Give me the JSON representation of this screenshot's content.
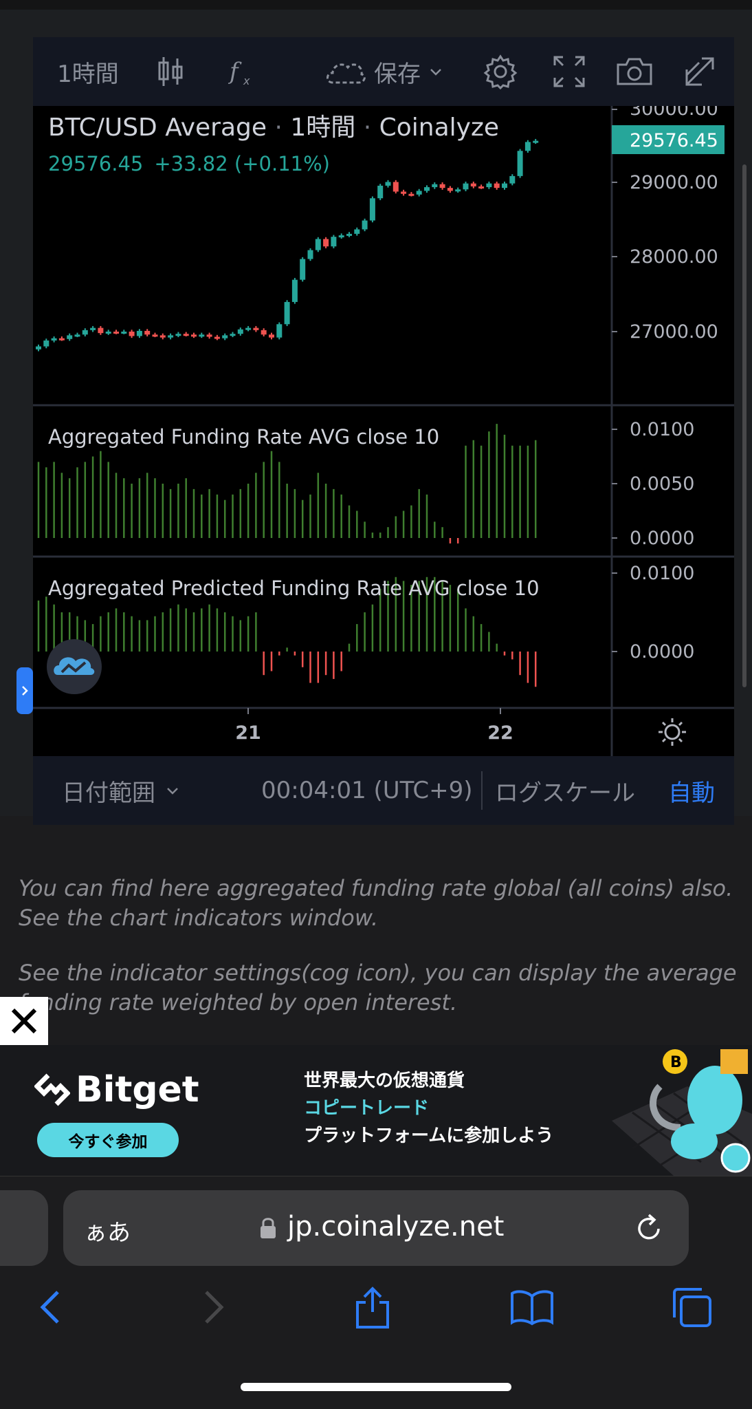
{
  "toolbar": {
    "interval": "1時間",
    "save_label": "保存"
  },
  "chart": {
    "title": "BTC/USD Average",
    "title_interval": "1時間",
    "title_source": "Coinalyze",
    "last_price": "29576.45",
    "change": "+33.82 (+0.11%)",
    "price_badge": "29576.45",
    "price_ticks": [
      "30000.00",
      "29000.00",
      "28000.00",
      "27000.00"
    ],
    "funding_title": "Aggregated Funding Rate AVG close 10",
    "funding_ticks": [
      "0.0100",
      "0.0050",
      "0.0000"
    ],
    "predicted_title": "Aggregated Predicted Funding Rate AVG close 10",
    "predicted_ticks": [
      "0.0100",
      "0.0000"
    ],
    "time_ticks": [
      "21",
      "22"
    ]
  },
  "bottombar": {
    "date_range": "日付範囲",
    "clock": "00:04:01 (UTC+9)",
    "log_scale": "ログスケール",
    "auto": "自動"
  },
  "description": {
    "p1": "You can find here aggregated funding rate global (all coins) also. See the chart indicators window.",
    "p2": "See the indicator settings(cog icon), you can display the average funding rate weighted by open interest."
  },
  "ad": {
    "brand": "Bitget",
    "cta": "今すぐ参加",
    "line1": "世界最大の仮想通貨",
    "line2": "コピートレード",
    "line3": "プラットフォームに参加しよう"
  },
  "browser": {
    "aa": "ぁあ",
    "url": "jp.coinalyze.net"
  },
  "colors": {
    "up": "#26a69a",
    "down": "#ef5350",
    "funding_green": "#3f7f2f",
    "link_blue": "#2e7cf6",
    "ad_cyan": "#5ad7e3"
  },
  "chart_data": {
    "type": "candlestick",
    "title": "BTC/USD Average · 1時間 · Coinalyze",
    "ylim": [
      26000,
      30000
    ],
    "price_close": [
      26800,
      26880,
      26910,
      26900,
      26950,
      26960,
      27020,
      27050,
      26980,
      27000,
      26990,
      27000,
      26940,
      27010,
      26960,
      26950,
      26920,
      26950,
      26970,
      26960,
      26940,
      26960,
      26930,
      26910,
      26950,
      26970,
      27030,
      27050,
      27020,
      26960,
      26920,
      27100,
      27400,
      27700,
      27980,
      28100,
      28250,
      28150,
      28280,
      28300,
      28320,
      28380,
      28500,
      28800,
      28970,
      29020,
      28890,
      28860,
      28850,
      28900,
      28950,
      28990,
      28940,
      28900,
      28920,
      29000,
      28960,
      28950,
      29000,
      28940,
      29000,
      29100,
      29440,
      29560,
      29576
    ],
    "funding_rate": [
      0.007,
      0.0065,
      0.007,
      0.006,
      0.0055,
      0.0065,
      0.007,
      0.0075,
      0.008,
      0.007,
      0.006,
      0.0055,
      0.005,
      0.0055,
      0.006,
      0.0055,
      0.005,
      0.0045,
      0.005,
      0.0055,
      0.0045,
      0.004,
      0.0045,
      0.004,
      0.0035,
      0.004,
      0.0045,
      0.005,
      0.006,
      0.007,
      0.008,
      0.007,
      0.005,
      0.0045,
      0.0035,
      0.004,
      0.006,
      0.005,
      0.0045,
      0.004,
      0.003,
      0.0025,
      0.0015,
      0.0005,
      0.0005,
      0.001,
      0.002,
      0.0025,
      0.003,
      0.0045,
      0.004,
      0.0015,
      0.001,
      -0.0005,
      -0.0005,
      0.0085,
      0.009,
      0.0085,
      0.0098,
      0.0105,
      0.0095,
      0.0085,
      0.0085,
      0.0085,
      0.009
    ],
    "predicted_funding_rate": [
      0.0065,
      0.007,
      0.006,
      0.005,
      0.005,
      0.0045,
      0.004,
      0.0035,
      0.0045,
      0.005,
      0.0055,
      0.005,
      0.0045,
      0.004,
      0.004,
      0.0045,
      0.005,
      0.0055,
      0.006,
      0.0055,
      0.005,
      0.0055,
      0.006,
      0.0055,
      0.005,
      0.0045,
      0.004,
      0.0045,
      0.005,
      -0.003,
      -0.0025,
      -0.0005,
      0.0005,
      -0.0005,
      -0.002,
      -0.004,
      -0.004,
      -0.003,
      -0.0035,
      -0.0025,
      0.001,
      0.0035,
      0.005,
      0.006,
      0.008,
      0.009,
      0.0095,
      0.009,
      0.0085,
      0.009,
      0.0095,
      0.0095,
      0.009,
      0.0085,
      0.008,
      0.0055,
      0.0045,
      0.0035,
      0.0025,
      0.001,
      -0.0005,
      -0.001,
      -0.003,
      -0.004,
      -0.0045
    ],
    "x_ticks": [
      "21",
      "22"
    ]
  }
}
